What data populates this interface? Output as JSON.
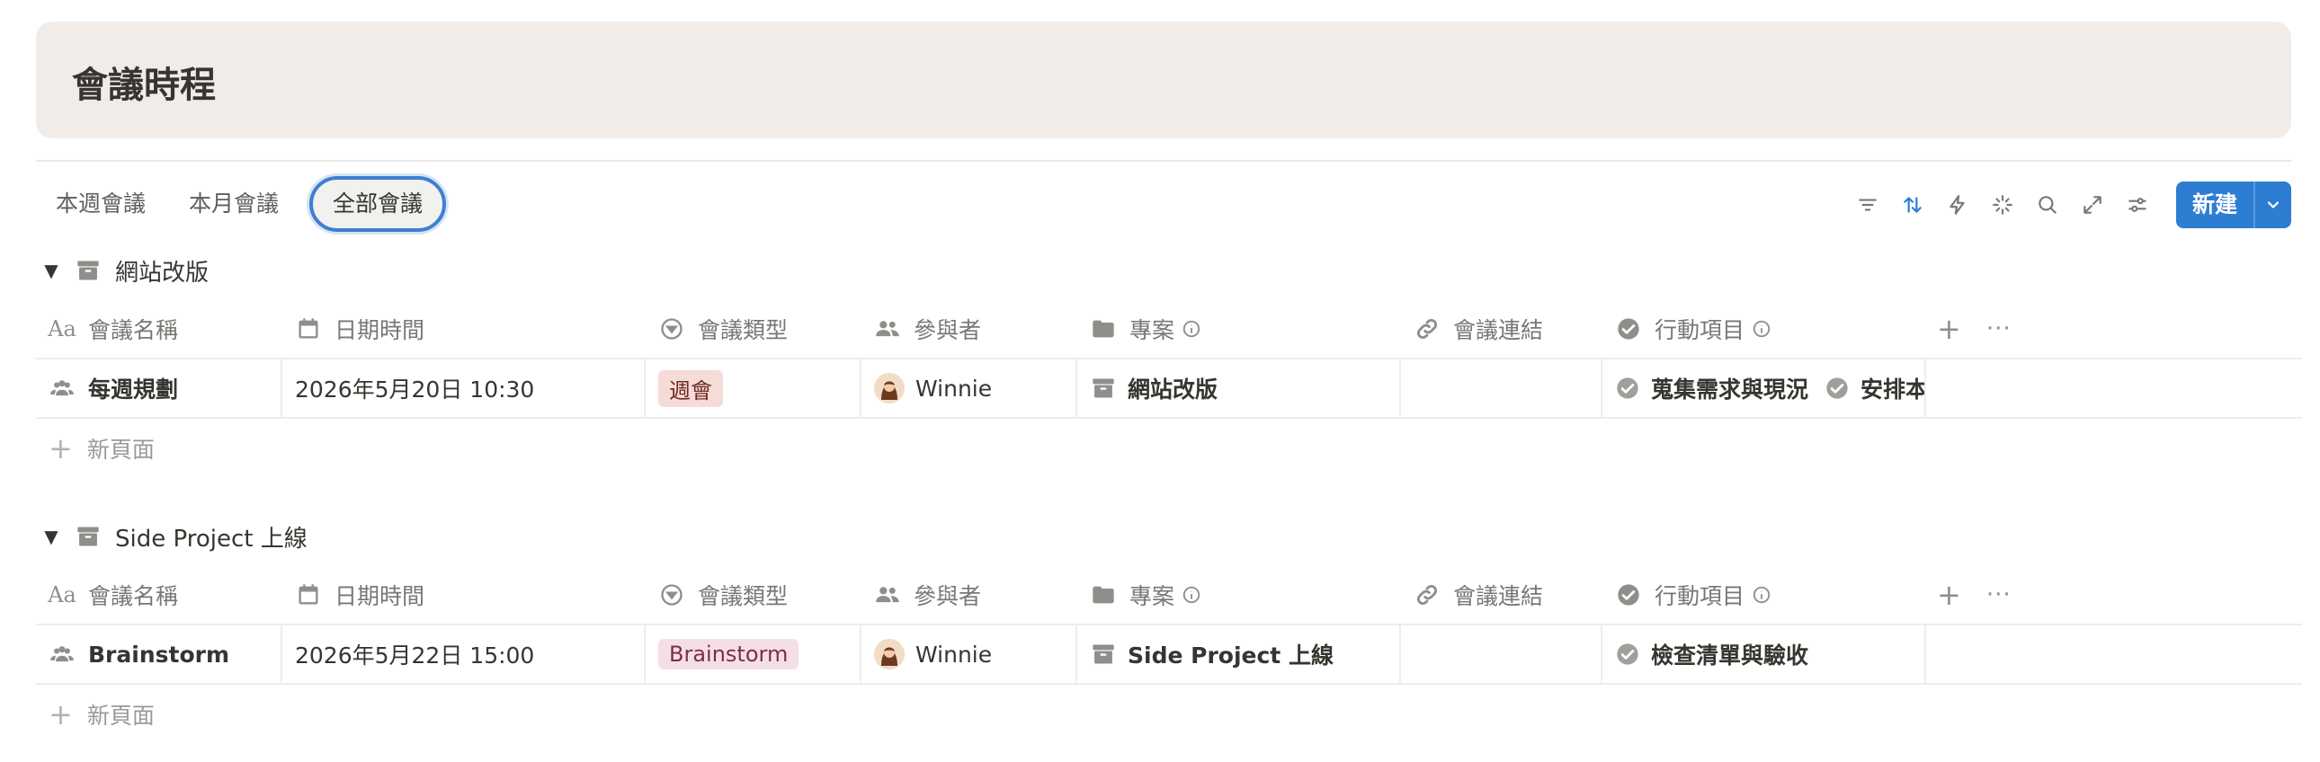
{
  "page": {
    "title": "會議時程"
  },
  "tabs": [
    {
      "label": "本週會議"
    },
    {
      "label": "本月會議"
    },
    {
      "label": "全部會議"
    }
  ],
  "toolbar": {
    "icons": [
      "filter-icon",
      "sort-icon",
      "automation-icon",
      "ai-icon",
      "search-icon",
      "expand-icon",
      "settings-icon"
    ],
    "new_label": "新建",
    "accent": "#2d7dd2"
  },
  "columns": [
    "會議名稱",
    "日期時間",
    "會議類型",
    "參與者",
    "專案",
    "會議連結",
    "行動項目"
  ],
  "groups": [
    {
      "name": "網站改版",
      "rows": [
        {
          "name": "每週規劃",
          "datetime": "2026年5月20日 10:30",
          "type": "週會",
          "participant": "Winnie",
          "project": "網站改版",
          "link": "",
          "actions": [
            "蒐集需求與現況",
            "安排本"
          ]
        }
      ],
      "new_page": "新頁面"
    },
    {
      "name": "Side Project 上線",
      "rows": [
        {
          "name": "Brainstorm",
          "datetime": "2026年5月22日 15:00",
          "type": "Brainstorm",
          "participant": "Winnie",
          "project": "Side Project 上線",
          "link": "",
          "actions": [
            "檢查清單與驗收"
          ]
        }
      ],
      "new_page": "新頁面"
    }
  ]
}
